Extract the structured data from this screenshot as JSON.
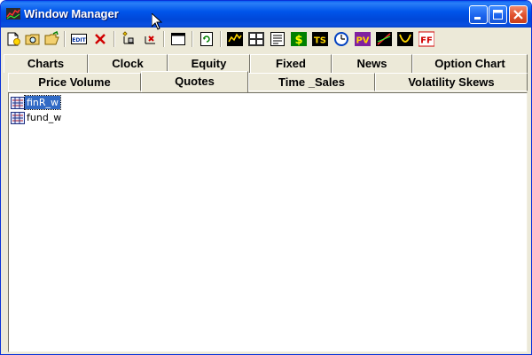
{
  "window": {
    "title": "Window Manager",
    "colors": {
      "titlebar": "#0055ea",
      "selection": "#316ac5",
      "close_button": "#e0502c",
      "face": "#ece9d8"
    }
  },
  "toolbar": {
    "buttons": [
      {
        "name": "new-icon"
      },
      {
        "name": "find-icon"
      },
      {
        "name": "open-folder-icon"
      },
      {
        "name": "edit-icon",
        "text": "EDIT"
      },
      {
        "name": "delete-icon"
      },
      {
        "name": "add-item-icon"
      },
      {
        "name": "remove-item-icon"
      },
      {
        "name": "window-icon"
      },
      {
        "name": "refresh-icon"
      },
      {
        "name": "price-chart-icon"
      },
      {
        "name": "calculator-icon"
      },
      {
        "name": "news-icon"
      },
      {
        "name": "dollar-icon",
        "text": "$"
      },
      {
        "name": "time-sales-icon",
        "text": "TS"
      },
      {
        "name": "clock-icon"
      },
      {
        "name": "price-volume-icon",
        "text": "PV"
      },
      {
        "name": "volatility-icon"
      },
      {
        "name": "smile-skew-icon"
      },
      {
        "name": "fixed-income-icon",
        "text": "FF"
      }
    ]
  },
  "tabs": {
    "row1": [
      "Charts",
      "Clock",
      "Equity",
      "Fixed",
      "News",
      "Option Chart"
    ],
    "row2": [
      "Price Volume",
      "Quotes",
      "Time _Sales",
      "Volatility Skews"
    ],
    "active": "Quotes"
  },
  "list": {
    "items": [
      {
        "label": "finR_w",
        "selected": true
      },
      {
        "label": "fund_w",
        "selected": false
      }
    ]
  }
}
